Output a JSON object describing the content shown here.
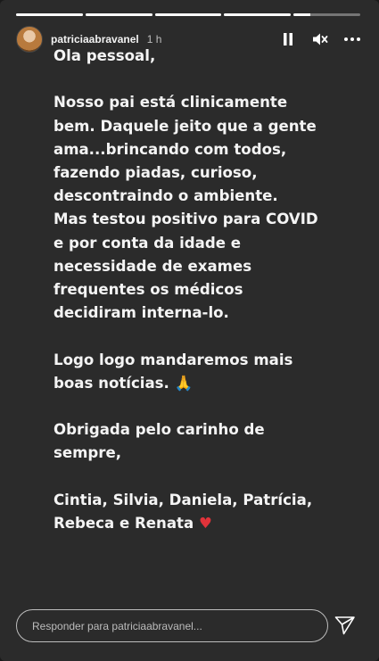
{
  "story": {
    "progress": [
      1,
      1,
      1,
      1,
      0.25
    ],
    "username": "patriciaabravanel",
    "time": "1 h",
    "icons": {
      "pause": "pause-icon",
      "mute": "volume-muted-icon",
      "more": "more-options-icon",
      "send": "send-icon"
    },
    "message": {
      "p1": "Ola pessoal,",
      "p2": "Nosso pai está clinicamente bem. Daquele jeito que a gente ama...brincando com todos, fazendo piadas, curioso, descontraindo o ambiente.  Mas testou positivo para COVID e por conta da idade e necessidade de exames frequentes os médicos decidiram interna-lo.",
      "p3": "Logo logo mandaremos mais boas notícias. 🙏",
      "p4": "Obrigada pelo carinho de sempre,",
      "p5": "Cintia, Silvia, Daniela, Patrícia, Rebeca e Renata",
      "heart": "♥"
    },
    "reply": {
      "placeholder": "Responder para patriciaabravanel..."
    }
  }
}
